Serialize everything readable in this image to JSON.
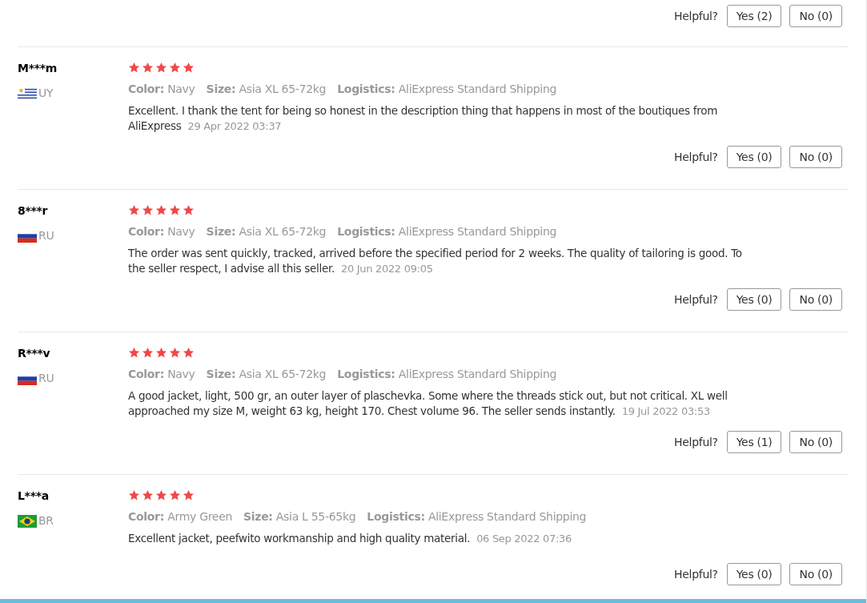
{
  "top_feedback": {
    "label": "Helpful?",
    "yes": "Yes (2)",
    "no": "No (0)"
  },
  "reviews": [
    {
      "name": "M***m",
      "country": "UY",
      "kind": "uy",
      "stars": 5,
      "color_label": "Color:",
      "color_value": "Navy",
      "size_label": "Size:",
      "size": "Asia XL 65-72kg",
      "logistics_label": "Logistics:",
      "logistics": "AliExpress Standard Shipping",
      "text": "Excellent. I thank the tent for being so honest in the description thing that happens in most of the boutiques from AliExpress",
      "date": "29 Apr 2022 03:37",
      "helpful": "Helpful?",
      "yes": "Yes (0)",
      "no": "No (0)"
    },
    {
      "name": "8***r",
      "country": "RU",
      "kind": "ru",
      "stars": 5,
      "color_label": "Color:",
      "color_value": "Navy",
      "size_label": "Size:",
      "size": "Asia XL 65-72kg",
      "logistics_label": "Logistics:",
      "logistics": "AliExpress Standard Shipping",
      "text": "The order was sent quickly, tracked, arrived before the specified period for 2 weeks. The quality of tailoring is good. To the seller respect, I advise all this seller.",
      "date": "20 Jun 2022 09:05",
      "helpful": "Helpful?",
      "yes": "Yes (0)",
      "no": "No (0)"
    },
    {
      "name": "R***v",
      "country": "RU",
      "kind": "ru",
      "stars": 5,
      "color_label": "Color:",
      "color_value": "Navy",
      "size_label": "Size:",
      "size": "Asia XL 65-72kg",
      "logistics_label": "Logistics:",
      "logistics": "AliExpress Standard Shipping",
      "text": "A good jacket, light, 500 gr, an outer layer of plaschevka. Some where the threads stick out, but not critical. XL well approached my size M, weight 63 kg, height 170. Chest volume 96. The seller sends instantly.",
      "date": "19 Jul 2022 03:53",
      "helpful": "Helpful?",
      "yes": "Yes (1)",
      "no": "No (0)"
    },
    {
      "name": "L***a",
      "country": "BR",
      "kind": "br",
      "stars": 5,
      "color_label": "Color:",
      "color_value": "Army Green",
      "size_label": "Size:",
      "size": "Asia L 55-65kg",
      "logistics_label": "Logistics:",
      "logistics": "AliExpress Standard Shipping",
      "text": "Excellent jacket, peefwito workmanship and high quality material.",
      "date": "06 Sep 2022 07:36",
      "helpful": "Helpful?",
      "yes": "Yes (0)",
      "no": "No (0)"
    }
  ]
}
